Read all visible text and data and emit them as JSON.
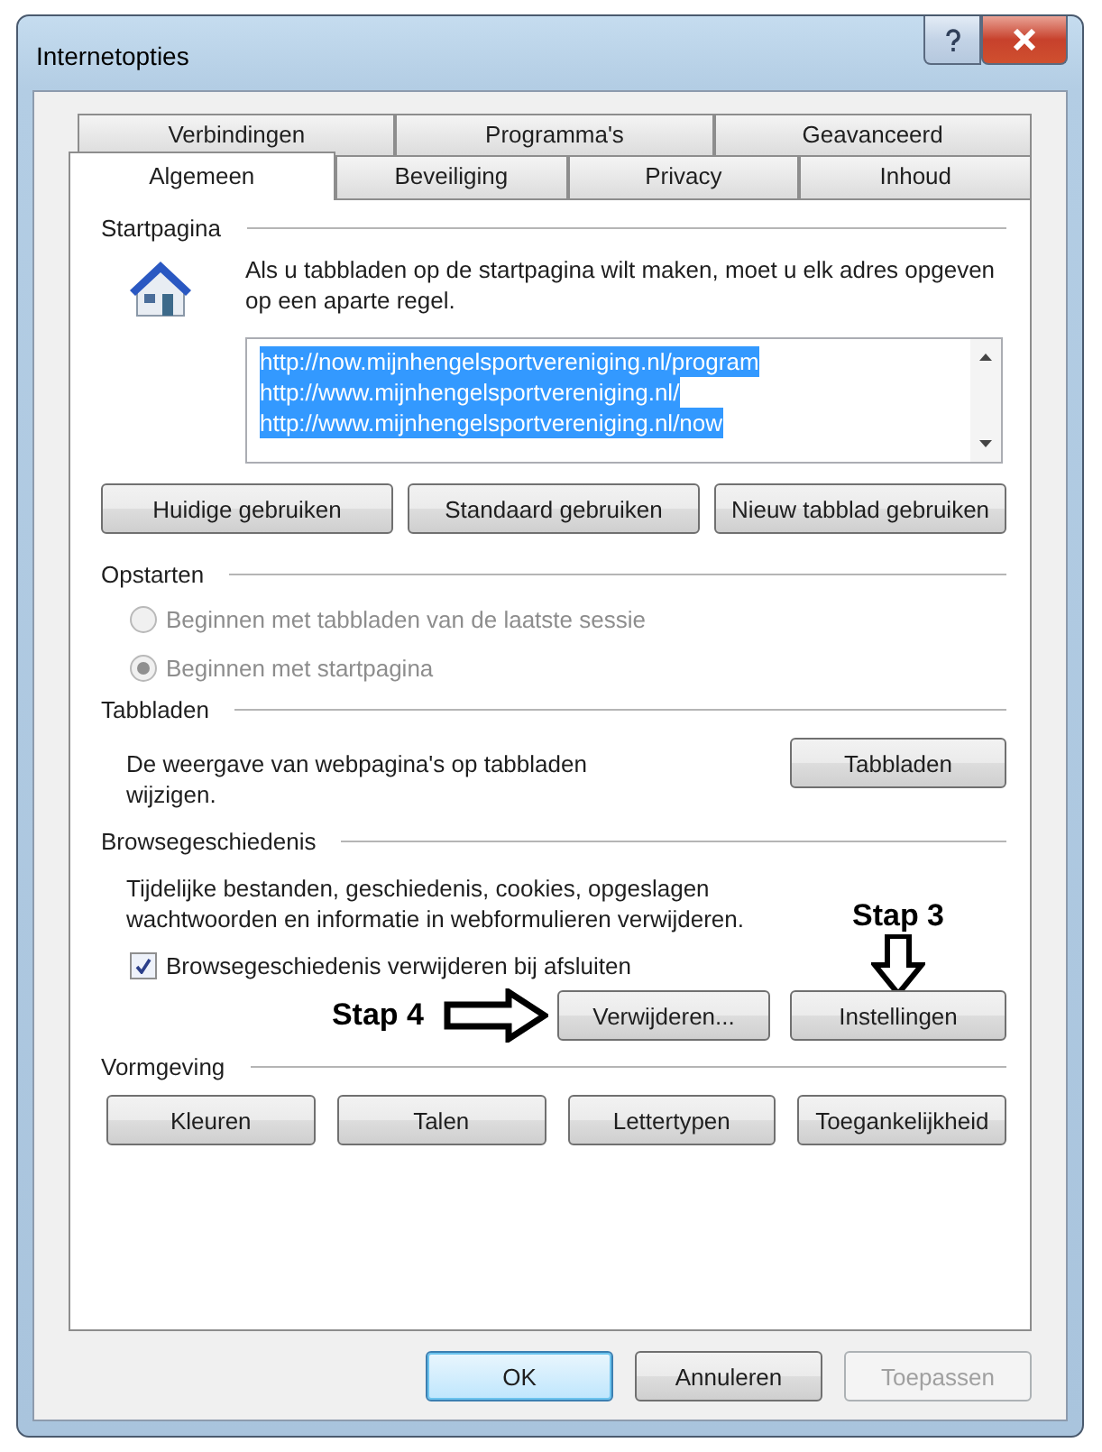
{
  "window": {
    "title": "Internetopties"
  },
  "tabs": [
    [
      {
        "label": "Verbindingen",
        "selected": false
      },
      {
        "label": "Programma's",
        "selected": false
      },
      {
        "label": "Geavanceerd",
        "selected": false
      }
    ],
    [
      {
        "label": "Algemeen",
        "selected": true
      },
      {
        "label": "Beveiliging",
        "selected": false
      },
      {
        "label": "Privacy",
        "selected": false
      },
      {
        "label": "Inhoud",
        "selected": false
      }
    ]
  ],
  "startpagina": {
    "heading": "Startpagina",
    "description": "Als u tabbladen op de startpagina wilt maken, moet u elk adres opgeven op een aparte regel.",
    "urls": [
      {
        "text": "http://now.mijnhengelsportvereniging.nl/program",
        "selected": true
      },
      {
        "text": "http://www.mijnhengelsportvereniging.nl/",
        "selected": true
      },
      {
        "text": "http://www.mijnhengelsportvereniging.nl/now",
        "selected": true
      }
    ],
    "buttons": [
      "Huidige gebruiken",
      "Standaard gebruiken",
      "Nieuw tabblad gebruiken"
    ]
  },
  "opstarten": {
    "heading": "Opstarten",
    "options": [
      {
        "label": "Beginnen met tabbladen van de laatste sessie",
        "selected": false,
        "disabled": true
      },
      {
        "label": "Beginnen met startpagina",
        "selected": true,
        "disabled": true
      }
    ]
  },
  "tabbladen": {
    "heading": "Tabbladen",
    "description": "De weergave van webpagina's op tabbladen wijzigen.",
    "button": "Tabbladen"
  },
  "browsegeschiedenis": {
    "heading": "Browsegeschiedenis",
    "description": "Tijdelijke bestanden, geschiedenis, cookies, opgeslagen wachtwoorden en informatie in webformulieren verwijderen.",
    "checkbox": {
      "label": "Browsegeschiedenis verwijderen bij afsluiten",
      "checked": true
    },
    "buttons": [
      "Verwijderen...",
      "Instellingen"
    ],
    "annotations": [
      {
        "kind": "down",
        "label": "Stap 3"
      },
      {
        "kind": "right",
        "label": "Stap 4"
      }
    ]
  },
  "vormgeving": {
    "heading": "Vormgeving",
    "buttons": [
      "Kleuren",
      "Talen",
      "Lettertypen",
      "Toegankelijkheid"
    ]
  },
  "footer": [
    {
      "label": "OK",
      "default": true,
      "disabled": false
    },
    {
      "label": "Annuleren",
      "default": false,
      "disabled": false
    },
    {
      "label": "Toepassen",
      "default": false,
      "disabled": true
    }
  ]
}
